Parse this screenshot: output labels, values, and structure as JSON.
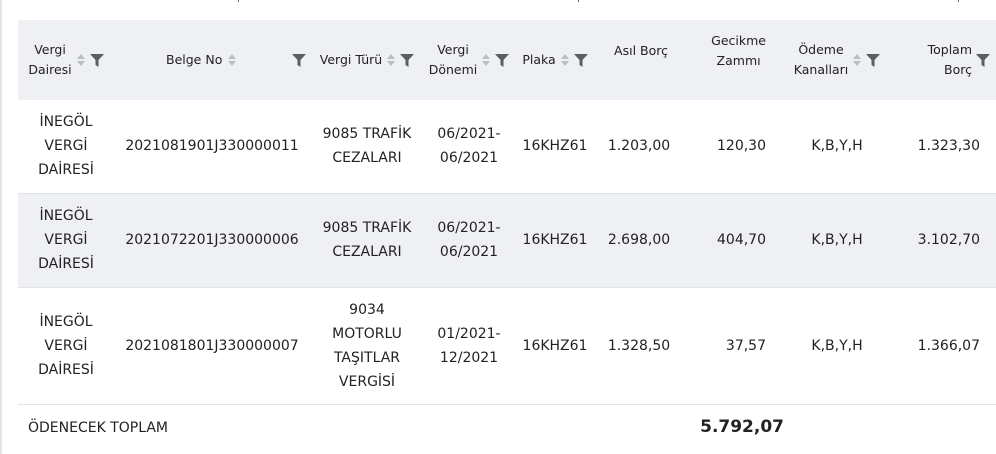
{
  "columns": [
    {
      "label_l1": "Vergi",
      "label_l2": "Dairesi"
    },
    {
      "label_l1": "Belge No",
      "label_l2": ""
    },
    {
      "label_l1": "Vergi Türü",
      "label_l2": ""
    },
    {
      "label_l1": "Vergi",
      "label_l2": "Dönemi"
    },
    {
      "label_l1": "Plaka",
      "label_l2": ""
    },
    {
      "label_l1": "Asıl Borç",
      "label_l2": ""
    },
    {
      "label_l1": "Gecikme",
      "label_l2": "Zammı"
    },
    {
      "label_l1": "Ödeme",
      "label_l2": "Kanalları"
    },
    {
      "label_l1": "Toplam",
      "label_l2": "Borç"
    }
  ],
  "rows": [
    {
      "daire": [
        "İNEGÖL",
        "VERGİ",
        "DAİRESİ"
      ],
      "belge_no": "2021081901J330000011",
      "tur": [
        "9085 TRAFİK",
        "CEZALARI"
      ],
      "donem": [
        "06/2021-",
        "06/2021"
      ],
      "plaka": "16KHZ61",
      "asil_borc": "1.203,00",
      "gecikme": "120,30",
      "kanallar": "K,B,Y,H",
      "toplam": "1.323,30"
    },
    {
      "daire": [
        "İNEGÖL",
        "VERGİ",
        "DAİRESİ"
      ],
      "belge_no": "2021072201J330000006",
      "tur": [
        "9085 TRAFİK",
        "CEZALARI"
      ],
      "donem": [
        "06/2021-",
        "06/2021"
      ],
      "plaka": "16KHZ61",
      "asil_borc": "2.698,00",
      "gecikme": "404,70",
      "kanallar": "K,B,Y,H",
      "toplam": "3.102,70"
    },
    {
      "daire": [
        "İNEGÖL",
        "VERGİ",
        "DAİRESİ"
      ],
      "belge_no": "2021081801J330000007",
      "tur": [
        "9034",
        "MOTORLU",
        "TAŞITLAR",
        "VERGİSİ"
      ],
      "donem": [
        "01/2021-",
        "12/2021"
      ],
      "plaka": "16KHZ61",
      "asil_borc": "1.328,50",
      "gecikme": "37,57",
      "kanallar": "K,B,Y,H",
      "toplam": "1.366,07"
    }
  ],
  "total": {
    "label": "ÖDENECEK TOPLAM",
    "value": "5.792,07"
  },
  "icons": {
    "sort": "sort-up-down-icon",
    "filter": "funnel-filter-icon"
  },
  "colors": {
    "header_bg": "#eef0f3",
    "alt_row_bg": "#eef0f3",
    "icon_gray": "#b9bec6",
    "filter_dark": "#5a5f66"
  }
}
